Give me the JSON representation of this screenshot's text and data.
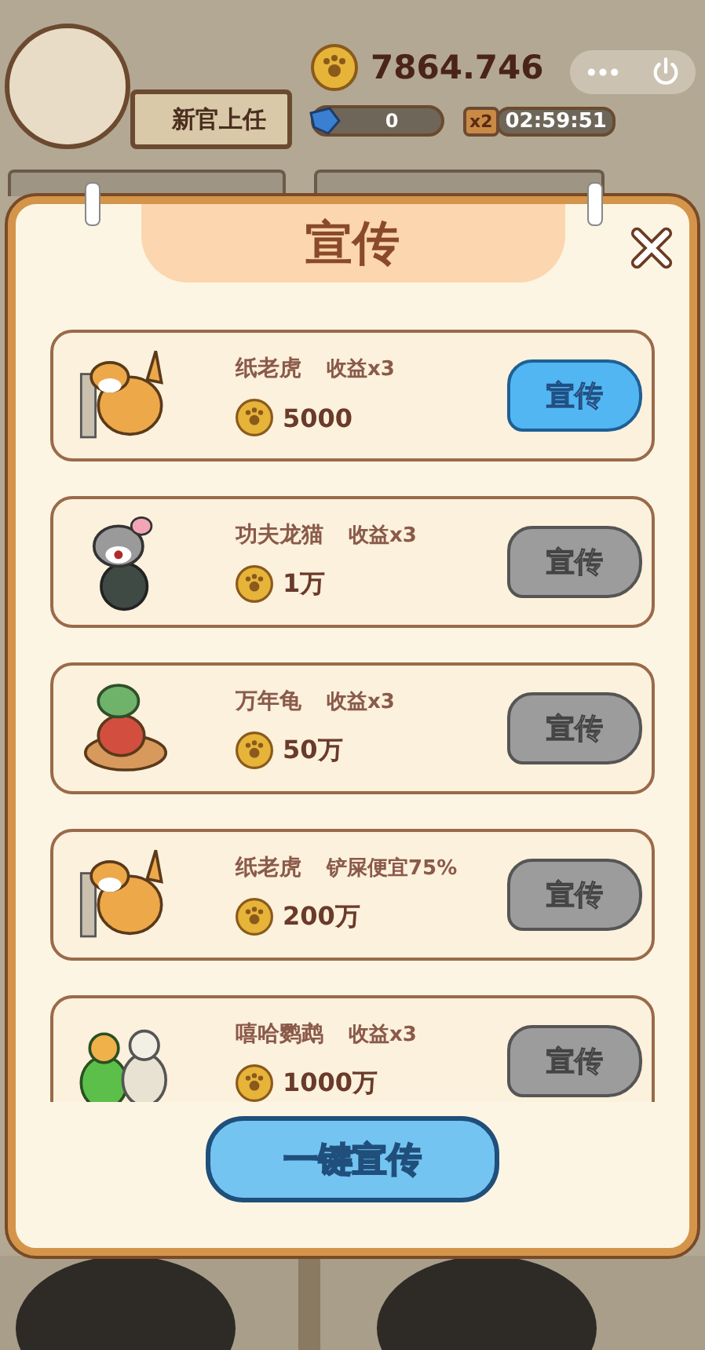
{
  "player": {
    "title": "新官上任"
  },
  "coins": "7864.746",
  "gems": "0",
  "boost": {
    "multiplier": "x2",
    "timer": "02:59:51"
  },
  "dialog": {
    "title": "宣传",
    "items": [
      {
        "kind": "cat",
        "name": "纸老虎",
        "effect": "收益x3",
        "cost": "5000",
        "action": "宣传",
        "enabled": true
      },
      {
        "kind": "hamster",
        "name": "功夫龙猫",
        "effect": "收益x3",
        "cost": "1万",
        "action": "宣传",
        "enabled": false
      },
      {
        "kind": "turtle",
        "name": "万年龟",
        "effect": "收益x3",
        "cost": "50万",
        "action": "宣传",
        "enabled": false
      },
      {
        "kind": "cat",
        "name": "纸老虎",
        "effect": "铲屎便宜75%",
        "cost": "200万",
        "action": "宣传",
        "enabled": false
      },
      {
        "kind": "parrots",
        "name": "嘻哈鹦鹉",
        "effect": "收益x3",
        "cost": "1000万",
        "action": "宣传",
        "enabled": false
      }
    ],
    "main_button": "一键宣传"
  }
}
